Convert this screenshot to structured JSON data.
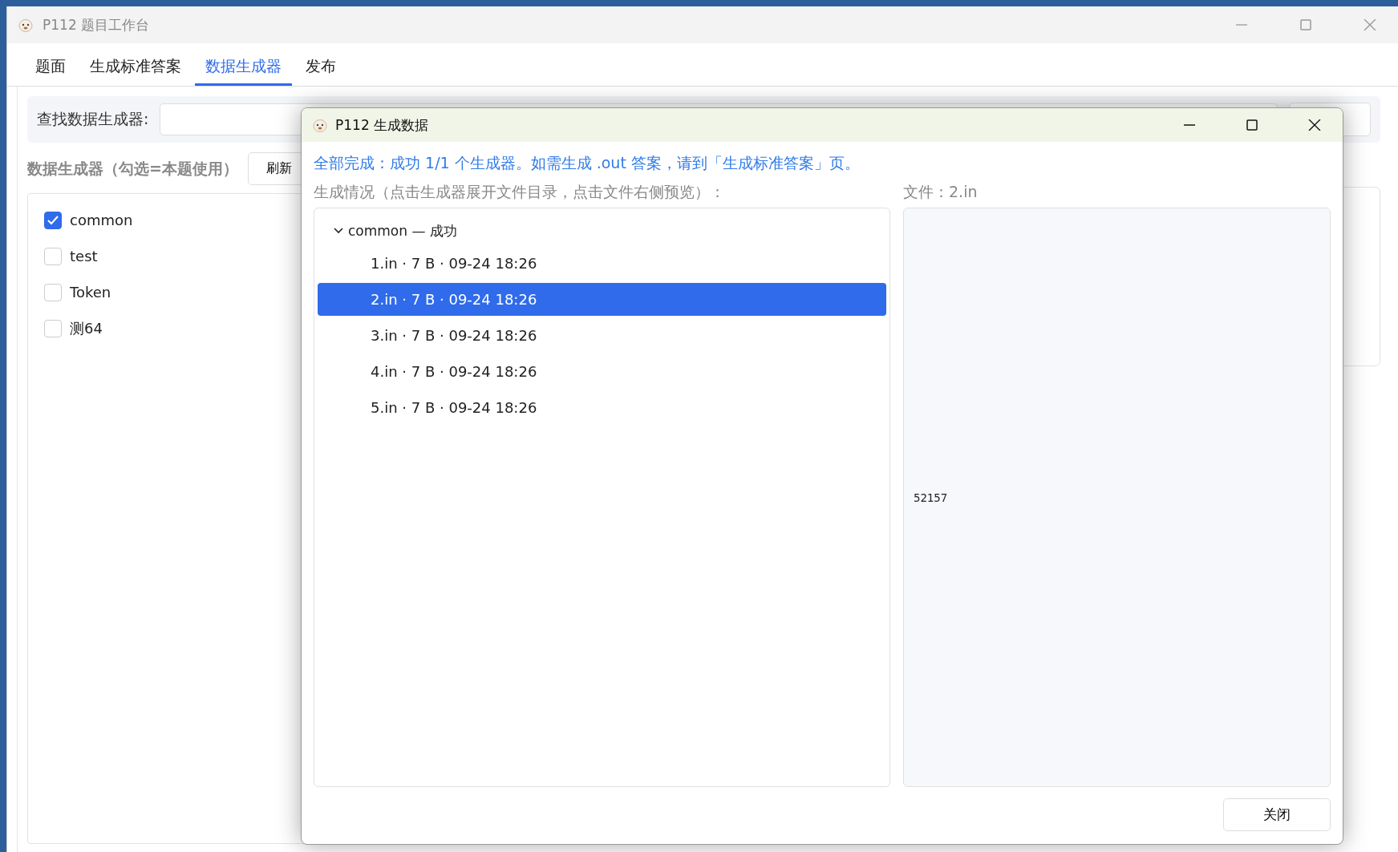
{
  "main_window": {
    "title": "P112 题目工作台",
    "tabs": [
      {
        "label": "题面",
        "selected": false
      },
      {
        "label": "生成标准答案",
        "selected": false
      },
      {
        "label": "数据生成器",
        "selected": true
      },
      {
        "label": "发布",
        "selected": false
      }
    ],
    "search": {
      "label": "查找数据生成器:"
    },
    "generators_heading": "数据生成器（勾选=本题使用）",
    "refresh_button": "刷新",
    "generators": [
      {
        "name": "common",
        "checked": true
      },
      {
        "name": "test",
        "checked": false
      },
      {
        "name": "Token",
        "checked": false
      },
      {
        "name": "测64",
        "checked": false
      }
    ]
  },
  "dialog": {
    "title": "P112 生成数据",
    "message": "全部完成：成功 1/1 个生成器。如需生成 .out 答案，请到「生成标准答案」页。",
    "tree_label": "生成情况（点击生成器展开文件目录，点击文件右侧预览）：",
    "tree": [
      {
        "label": "common — 成功",
        "expanded": true,
        "children": [
          {
            "label": "1.in · 7 B · 09-24 18:26",
            "selected": false
          },
          {
            "label": "2.in · 7 B · 09-24 18:26",
            "selected": true
          },
          {
            "label": "3.in · 7 B · 09-24 18:26",
            "selected": false
          },
          {
            "label": "4.in · 7 B · 09-24 18:26",
            "selected": false
          },
          {
            "label": "5.in · 7 B · 09-24 18:26",
            "selected": false
          }
        ]
      }
    ],
    "preview_label": "文件：2.in",
    "preview_content": "52157",
    "close_button": "关闭"
  }
}
